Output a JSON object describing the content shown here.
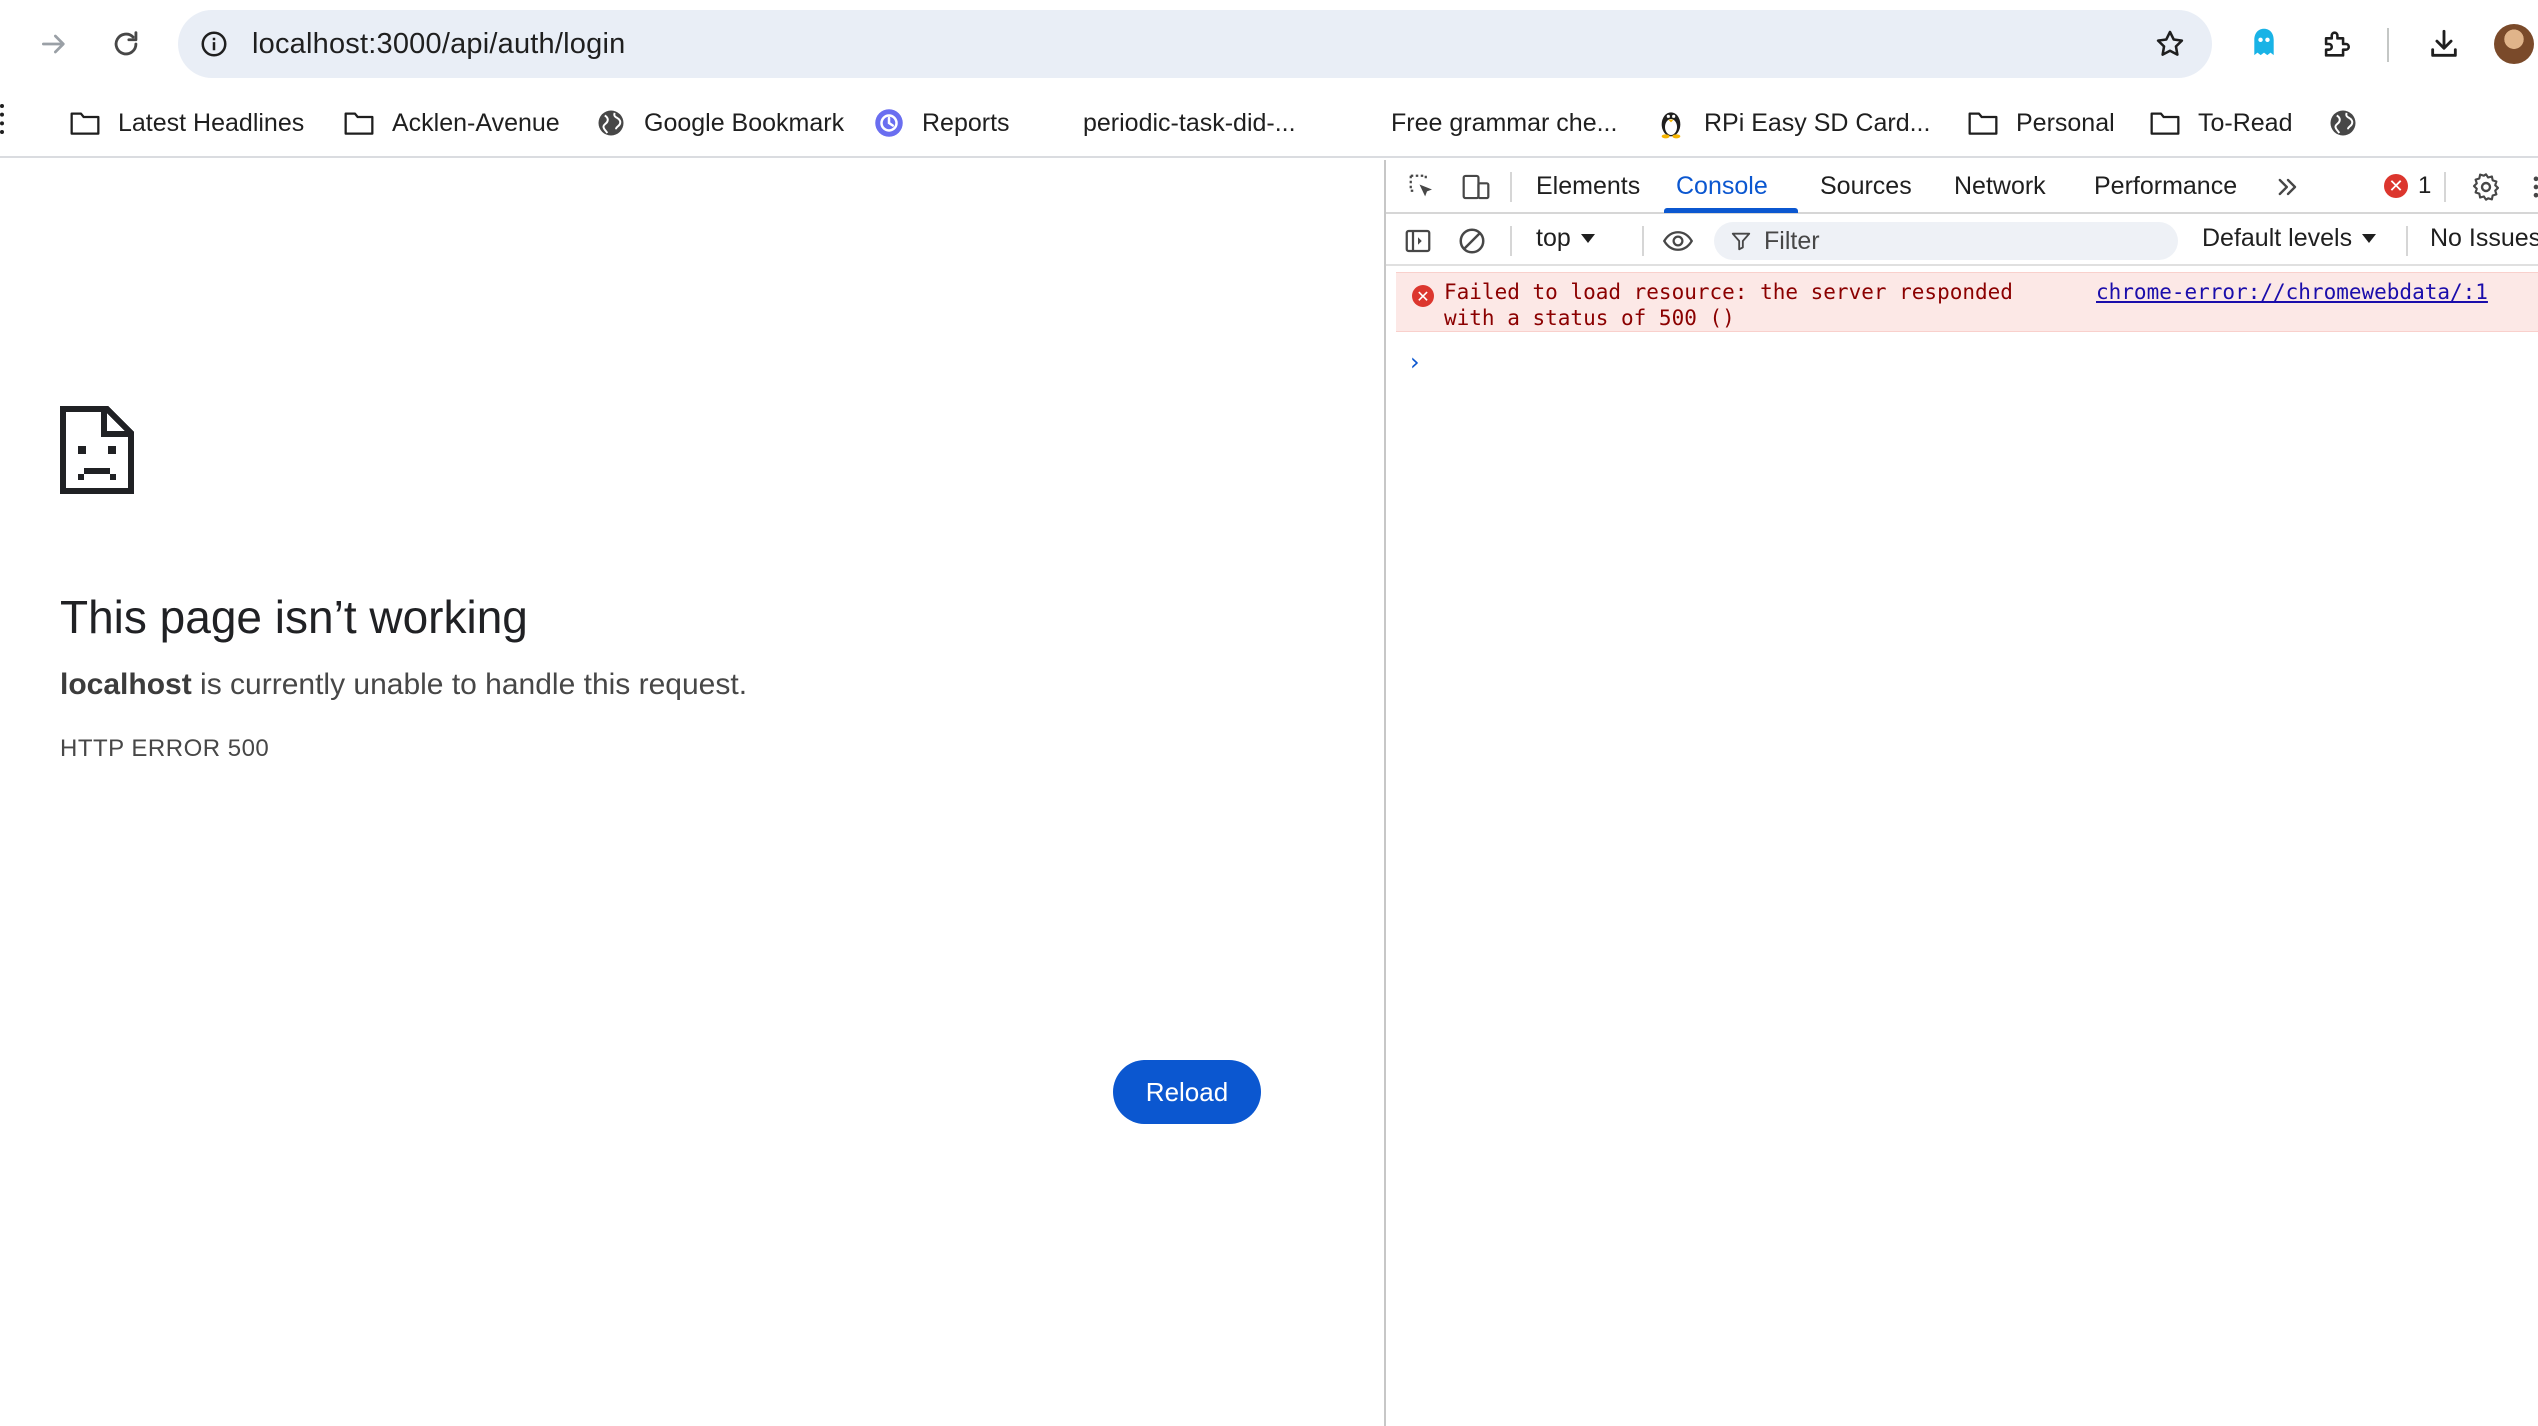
{
  "browser": {
    "url": "localhost:3000/api/auth/login"
  },
  "bookmarks": [
    {
      "label": "Latest Headlines",
      "icon": "folder-icon"
    },
    {
      "label": "Acklen-Avenue",
      "icon": "folder-icon"
    },
    {
      "label": "Google Bookmark",
      "icon": "globe-icon"
    },
    {
      "label": "Reports",
      "icon": "reports-app-icon"
    },
    {
      "label": "periodic-task-did-...",
      "icon": "none"
    },
    {
      "label": "Free grammar che...",
      "icon": "none"
    },
    {
      "label": "RPi Easy SD Card...",
      "icon": "linux-penguin-icon"
    },
    {
      "label": "Personal",
      "icon": "folder-icon"
    },
    {
      "label": "To-Read",
      "icon": "folder-icon"
    }
  ],
  "error_page": {
    "title": "This page isn’t working",
    "host": "localhost",
    "description_rest": " is currently unable to handle this request.",
    "error_code": "HTTP ERROR 500",
    "reload_label": "Reload"
  },
  "devtools": {
    "tabs": [
      {
        "label": "Elements",
        "active": false
      },
      {
        "label": "Console",
        "active": true
      },
      {
        "label": "Sources",
        "active": false
      },
      {
        "label": "Network",
        "active": false
      },
      {
        "label": "Performance",
        "active": false
      }
    ],
    "error_count": "1",
    "context": "top",
    "filter_placeholder": "Filter",
    "levels": "Default levels",
    "issues": "No Issues",
    "messages": [
      {
        "level": "error",
        "text": "Failed to load resource: the server responded\nwith a status of 500 ()",
        "source": "chrome-error://chromewebdata/:1"
      }
    ],
    "prompt_symbol": "›"
  },
  "colors": {
    "accent": "#0b57d0",
    "error": "#dc362e",
    "error_bg": "#fce8e6",
    "omnibox_bg": "#e9eef6"
  }
}
